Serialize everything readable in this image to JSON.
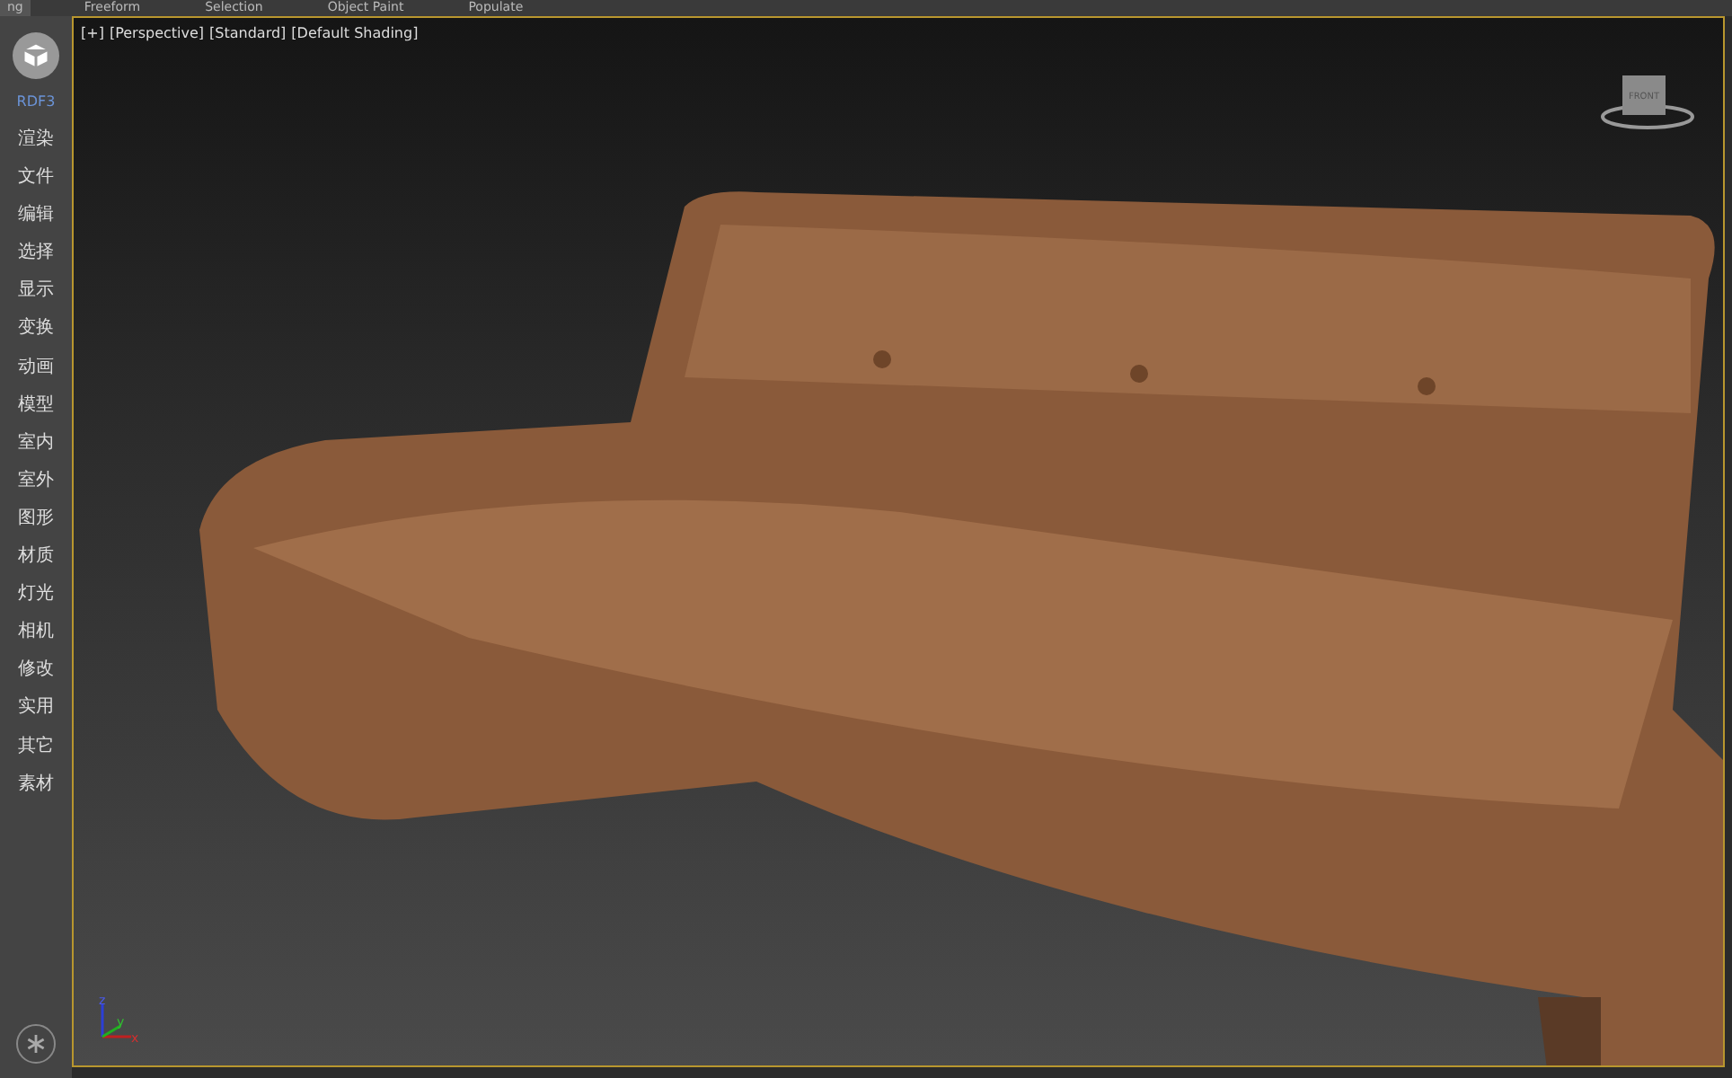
{
  "ribbon_tabs": [
    {
      "label": "ng",
      "selected": true
    },
    {
      "label": "Freeform",
      "selected": false
    },
    {
      "label": "Selection",
      "selected": false
    },
    {
      "label": "Object Paint",
      "selected": false
    },
    {
      "label": "Populate",
      "selected": false
    }
  ],
  "sidebar": {
    "plugin_label": "RDF3",
    "items": [
      {
        "label": "渲染"
      },
      {
        "label": "文件"
      },
      {
        "label": "编辑"
      },
      {
        "label": "选择"
      },
      {
        "label": "显示"
      },
      {
        "label": "变换"
      },
      {
        "label": "动画"
      },
      {
        "label": "模型"
      },
      {
        "label": "室内"
      },
      {
        "label": "室外"
      },
      {
        "label": "图形"
      },
      {
        "label": "材质"
      },
      {
        "label": "灯光"
      },
      {
        "label": "相机"
      },
      {
        "label": "修改"
      },
      {
        "label": "实用"
      },
      {
        "label": "其它"
      },
      {
        "label": "素材"
      }
    ]
  },
  "viewport": {
    "labels": [
      "[+]",
      "[Perspective]",
      "[Standard]",
      "[Default Shading]"
    ],
    "viewcube_face": "FRONT",
    "axes": [
      "z",
      "y",
      "x"
    ]
  }
}
